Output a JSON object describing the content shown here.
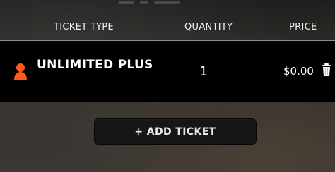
{
  "table": {
    "headers": {
      "ticket_type": "TICKET TYPE",
      "quantity": "QUANTITY",
      "price": "PRICE"
    },
    "rows": [
      {
        "ticket_type": "UNLIMITED PLUS",
        "quantity": "1",
        "price": "$0.00",
        "icon": "user-icon",
        "delete_icon": "trash-icon"
      }
    ]
  },
  "actions": {
    "add_ticket_label": "+ ADD TICKET"
  },
  "colors": {
    "accent": "#ff5a1f",
    "row_background": "#000000",
    "text": "#ffffff",
    "button_background": "#141414"
  }
}
